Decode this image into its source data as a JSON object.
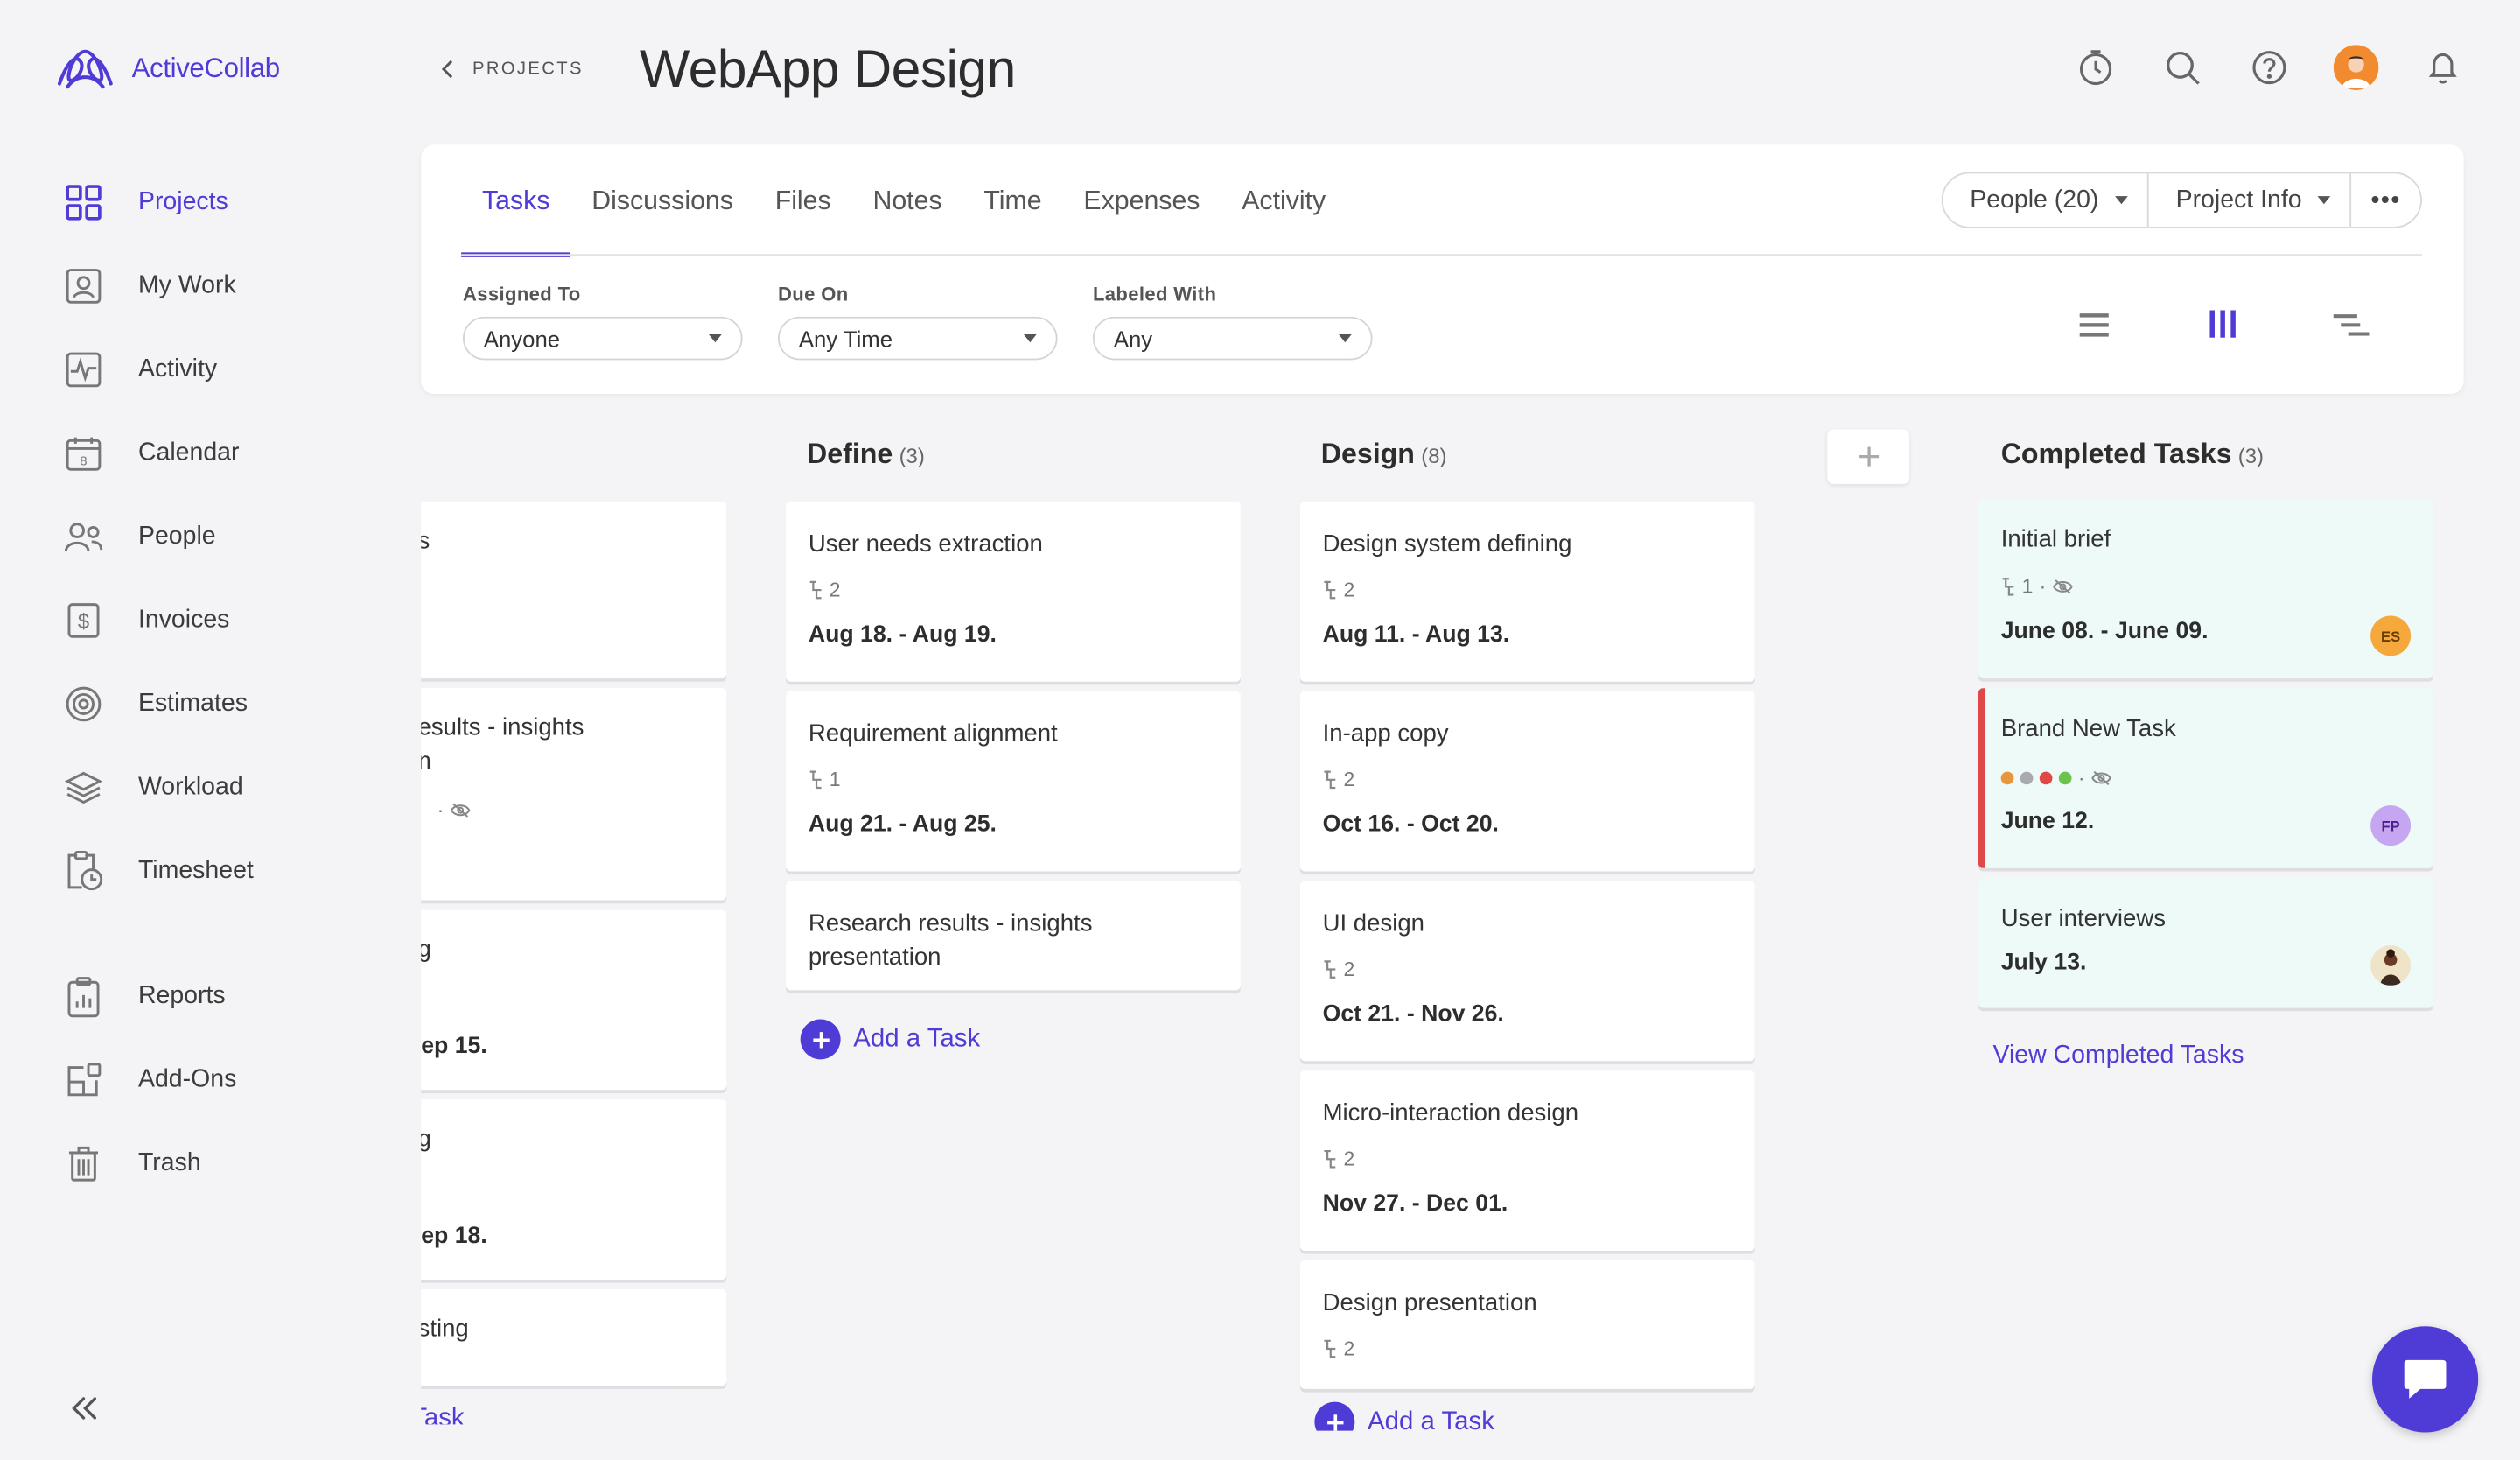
{
  "app": {
    "name": "ActiveCollab"
  },
  "sidebar": {
    "items": [
      {
        "label": "Projects",
        "icon": "projects-grid-icon",
        "active": true
      },
      {
        "label": "My Work",
        "icon": "user-badge-icon"
      },
      {
        "label": "Activity",
        "icon": "activity-icon"
      },
      {
        "label": "Calendar",
        "icon": "calendar-icon",
        "day": "8"
      },
      {
        "label": "People",
        "icon": "people-icon"
      },
      {
        "label": "Invoices",
        "icon": "invoice-icon"
      },
      {
        "label": "Estimates",
        "icon": "target-icon"
      },
      {
        "label": "Workload",
        "icon": "layers-icon"
      },
      {
        "label": "Timesheet",
        "icon": "timesheet-icon"
      },
      {
        "label": "Reports",
        "icon": "clipboard-chart-icon"
      },
      {
        "label": "Add-Ons",
        "icon": "addons-icon"
      },
      {
        "label": "Trash",
        "icon": "trash-icon"
      }
    ]
  },
  "header": {
    "breadcrumb": "PROJECTS",
    "title": "WebApp Design"
  },
  "tabs": [
    "Tasks",
    "Discussions",
    "Files",
    "Notes",
    "Time",
    "Expenses",
    "Activity"
  ],
  "actions": {
    "people": "People (20)",
    "project_info": "Project Info",
    "more": "•••"
  },
  "filters": {
    "assigned": {
      "label": "Assigned To",
      "value": "Anyone"
    },
    "due": {
      "label": "Due On",
      "value": "Any Time"
    },
    "labeled": {
      "label": "Labeled With",
      "value": "Any"
    }
  },
  "columns": {
    "first": {
      "tasks": [
        {
          "name": "s"
        },
        {
          "name": "esults - insights",
          "name2": "n"
        },
        {
          "name": "g",
          "date": "ep 15."
        },
        {
          "name": "g",
          "date": "ep 18."
        },
        {
          "name": "sting"
        }
      ],
      "add": "Task"
    },
    "define": {
      "title": "Define",
      "count": "(3)",
      "tasks": [
        {
          "name": "User needs extraction",
          "subtasks": "2",
          "date": "Aug 18. - Aug 19."
        },
        {
          "name": "Requirement alignment",
          "subtasks": "1",
          "date": "Aug 21. - Aug 25."
        },
        {
          "name": "Research results - insights",
          "name2": "presentation"
        }
      ],
      "add": "Add a Task"
    },
    "design": {
      "title": "Design",
      "count": "(8)",
      "tasks": [
        {
          "name": "Design system defining",
          "subtasks": "2",
          "date": "Aug 11. - Aug 13."
        },
        {
          "name": "In-app copy",
          "subtasks": "2",
          "date": "Oct 16. - Oct 20."
        },
        {
          "name": "UI design",
          "subtasks": "2",
          "date": "Oct 21. - Nov 26."
        },
        {
          "name": "Micro-interaction design",
          "subtasks": "2",
          "date": "Nov 27. - Dec 01."
        },
        {
          "name": "Design presentation",
          "subtasks": "2"
        }
      ],
      "add": "Add a Task"
    },
    "completed": {
      "title": "Completed Tasks",
      "count": "(3)",
      "tasks": [
        {
          "name": "Initial brief",
          "subtasks": "1",
          "date": "June 08. - June 09.",
          "assignee": "ES"
        },
        {
          "name": "Brand New Task",
          "date": "June 12.",
          "assignee": "FP"
        },
        {
          "name": "User interviews",
          "date": "July 13."
        }
      ],
      "view_all": "View Completed Tasks"
    }
  },
  "colors": {
    "accent": "#4f3bd6",
    "danger": "#e04848",
    "done_bg": "#eefaf8"
  }
}
